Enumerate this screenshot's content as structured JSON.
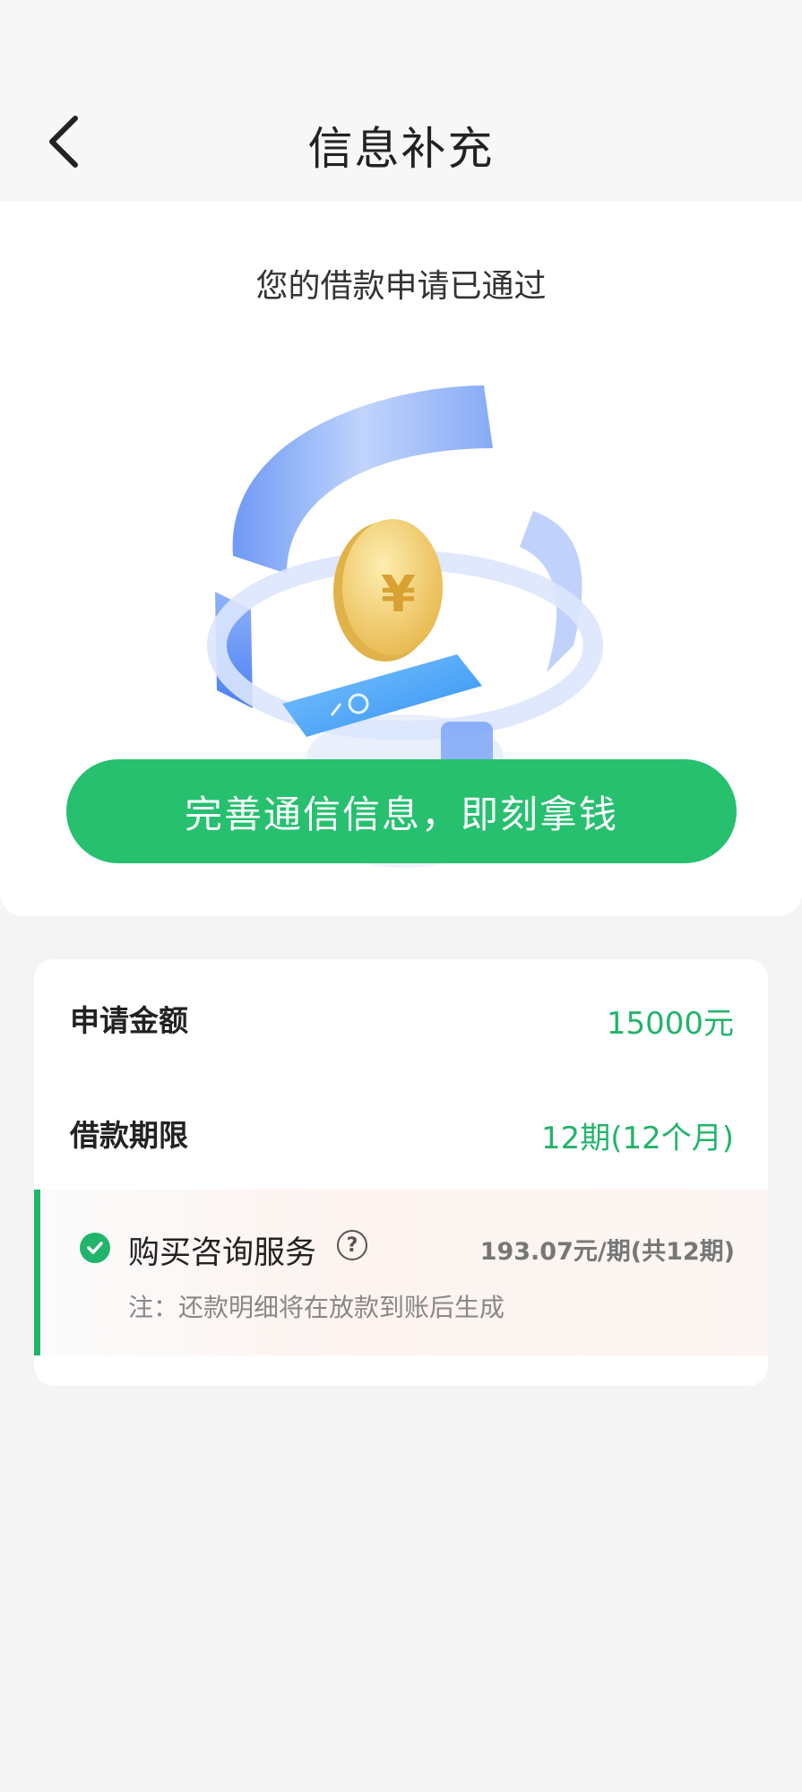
{
  "header": {
    "title": "信息补充",
    "back_icon": "chevron-left-icon"
  },
  "approval": {
    "message": "您的借款申请已通过",
    "illustration_icon": "coin-phone-illustration"
  },
  "cta": {
    "label": "完善通信信息，即刻拿钱",
    "color": "#26c06f"
  },
  "loan": {
    "amount_label": "申请金额",
    "amount_value": "15000元",
    "term_label": "借款期限",
    "term_value": "12期(12个月)",
    "value_color": "#22b46a"
  },
  "service": {
    "label": "购买咨询服务",
    "checked": true,
    "help_icon": "question-circle-icon",
    "help_glyph": "?",
    "price": "193.07元/期(共12期)",
    "note": "注：还款明细将在放款到账后生成"
  }
}
